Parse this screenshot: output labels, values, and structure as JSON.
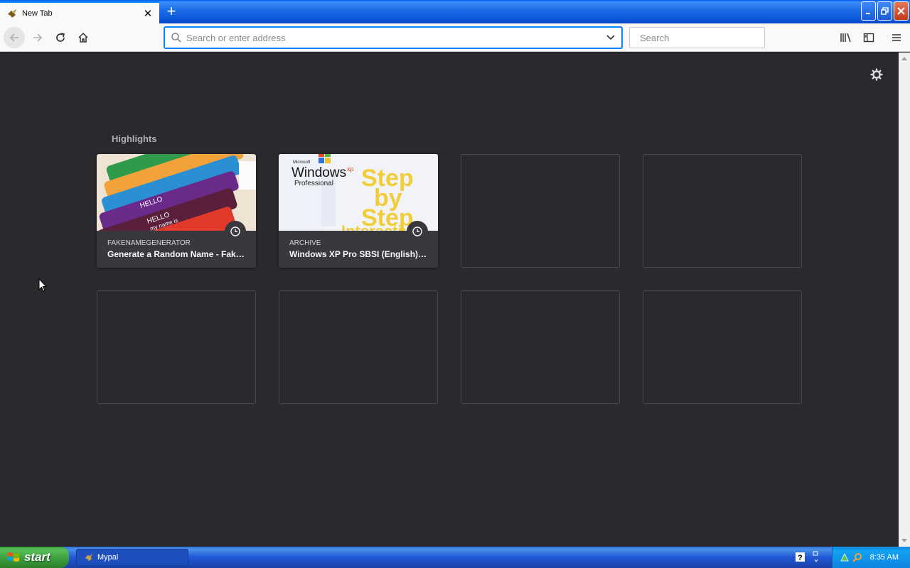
{
  "tab": {
    "title": "New Tab",
    "close": "✕"
  },
  "newtab": "+",
  "urlbar": {
    "placeholder": "Search or enter address"
  },
  "searchbar": {
    "placeholder": "Search"
  },
  "highlights": {
    "title": "Highlights",
    "cards": [
      {
        "host": "FAKENAMEGENERATOR",
        "title": "Generate a Random Name - Fake Name Generator"
      },
      {
        "host": "ARCHIVE",
        "title": "Windows XP Pro SBSI (English) : Free Download"
      }
    ]
  },
  "thumb2": {
    "brand_small": "Microsoft",
    "brand": "Windows",
    "brand_sup": "xp",
    "edition": "Professional",
    "line1": "Step",
    "line2": "by",
    "line3": "Step",
    "line4": "Interactive"
  },
  "thumb1": {
    "tag1": "HELLO",
    "tag2": "HELLO",
    "tag3": "my name is"
  },
  "taskbar": {
    "start": "start",
    "window": "Mypal",
    "time": "8:35 AM"
  }
}
